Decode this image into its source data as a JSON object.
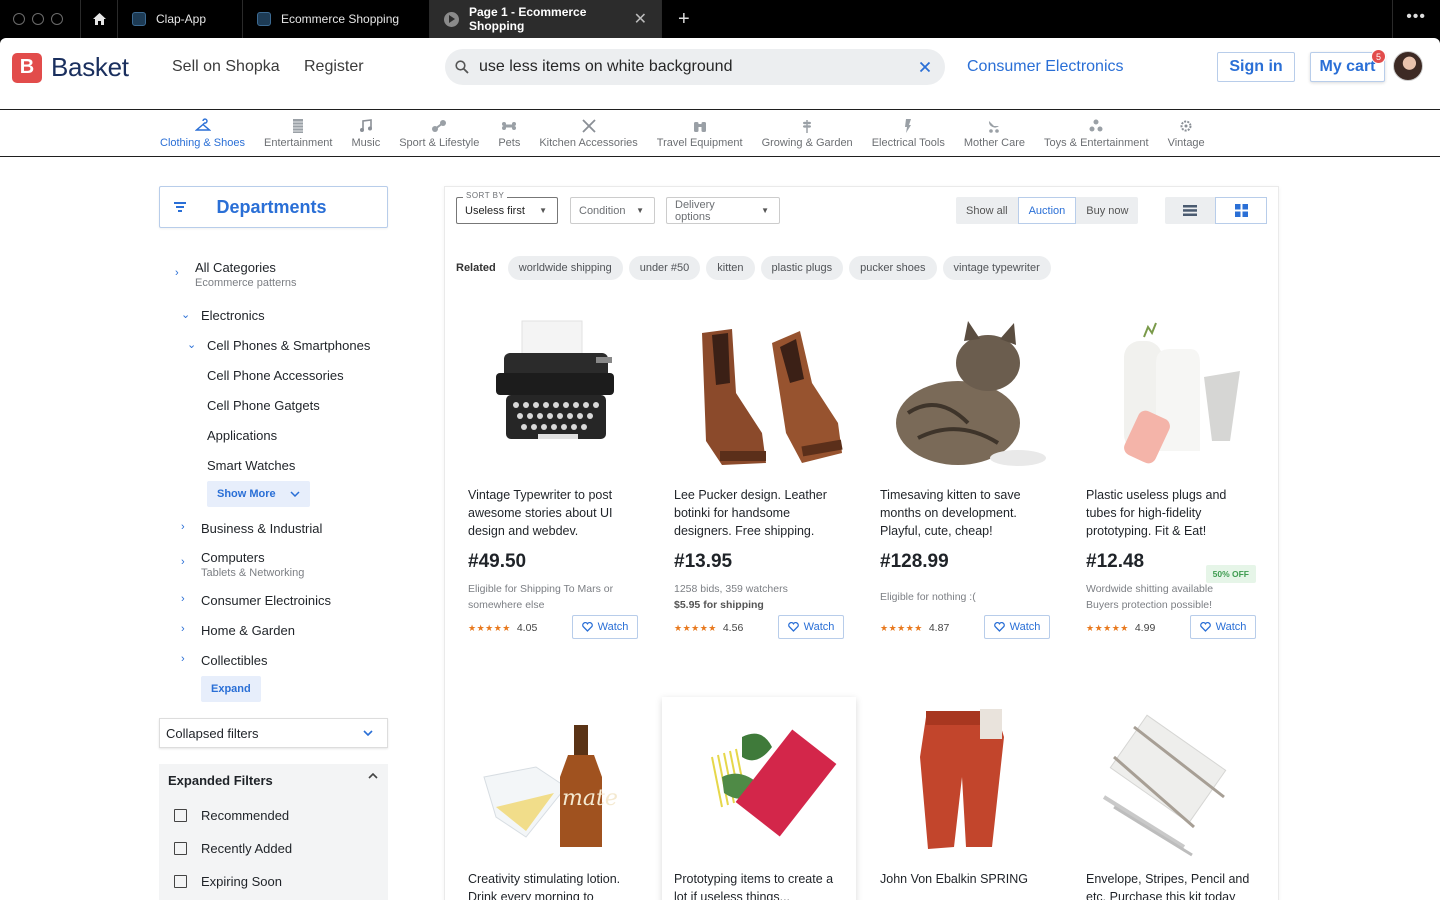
{
  "browser": {
    "tabs": [
      {
        "label": "Clap-App"
      },
      {
        "label": "Ecommerce Shopping"
      },
      {
        "label": "Page 1 - Ecommerce Shopping",
        "active": true
      }
    ],
    "new_tab": "+",
    "close": "✕",
    "more": "•••"
  },
  "header": {
    "logo_letter": "B",
    "logo_text": "Basket",
    "links": [
      "Sell on Shopka",
      "Register"
    ],
    "search_value": "use less items on white background",
    "category_link": "Consumer Electronics",
    "sign_in": "Sign in",
    "cart": "My cart",
    "cart_count": "5"
  },
  "categories": [
    {
      "label": "Clothing & Shoes",
      "icon": "hanger-icon",
      "active": true
    },
    {
      "label": "Entertainment",
      "icon": "film-icon"
    },
    {
      "label": "Music",
      "icon": "music-icon"
    },
    {
      "label": "Sport & Lifestyle",
      "icon": "bike-icon"
    },
    {
      "label": "Pets",
      "icon": "bone-icon"
    },
    {
      "label": "Kitchen Accessories",
      "icon": "utensils-icon"
    },
    {
      "label": "Travel Equipment",
      "icon": "binoculars-icon"
    },
    {
      "label": "Growing & Garden",
      "icon": "wheat-icon"
    },
    {
      "label": "Electrical Tools",
      "icon": "plug-icon"
    },
    {
      "label": "Mother Care",
      "icon": "stroller-icon"
    },
    {
      "label": "Toys & Entertainment",
      "icon": "toys-icon"
    },
    {
      "label": "Vintage",
      "icon": "gear-icon"
    }
  ],
  "sidebar": {
    "departments": "Departments",
    "tree": {
      "all": "All Categories",
      "all_sub": "Ecommerce patterns",
      "electronics": "Electronics",
      "cell": "Cell Phones & Smartphones",
      "cell_children": [
        "Cell Phone Accessories",
        "Cell Phone Gatgets",
        "Applications",
        "Smart Watches"
      ],
      "show_more": "Show More",
      "business": "Business & Industrial",
      "computers": "Computers",
      "computers_sub": "Tablets & Networking",
      "consumer": "Consumer Electroinics",
      "home": "Home & Garden",
      "collectibles": "Collectibles",
      "expand": "Expand"
    },
    "collapsed_filters": "Collapsed filters",
    "expanded_filters": "Expanded Filters",
    "checks": [
      "Recommended",
      "Recently Added",
      "Expiring Soon"
    ]
  },
  "toolbar": {
    "sort_label": "SORT BY",
    "sort_value": "Useless first",
    "condition": "Condition",
    "delivery": "Delivery options",
    "filters": [
      "Show all",
      "Auction",
      "Buy now"
    ],
    "active_filter": "Auction"
  },
  "related": {
    "label": "Related",
    "chips": [
      "worldwide shipping",
      "under #50",
      "kitten",
      "plastic plugs",
      "pucker shoes",
      "vintage typewriter"
    ]
  },
  "watch_label": "Watch",
  "products": [
    {
      "title": "Vintage Typewriter to post awesome stories about UI design and webdev.",
      "price": "#49.50",
      "note": [
        "Eligible for Shipping To Mars or",
        "somewhere else"
      ],
      "rating": "4.05"
    },
    {
      "title": "Lee Pucker design. Leather botinki for handsome designers. Free shipping.",
      "price": "#13.95",
      "note": [
        "1258 bids, 359 watchers"
      ],
      "note_bold": "$5.95 for shipping",
      "rating": "4.56"
    },
    {
      "title": "Timesaving kitten to save months on development. Playful, cute, cheap!",
      "price": "#128.99",
      "note": [
        "Eligible for nothing :("
      ],
      "rating": "4.87"
    },
    {
      "title": "Plastic useless plugs and tubes for high-fidelity prototyping. Fit & Eat!",
      "price": "#12.48",
      "badge": "50% OFF",
      "note": [
        "Wordwide shitting available",
        "Buyers protection possible!"
      ],
      "rating": "4.99"
    },
    {
      "title": "Creativity stimulating lotion. Drink every morning to generate better ideas!"
    },
    {
      "title": "Prototyping items to create a lot if useless things..."
    },
    {
      "title": "John Von Ebalkin SPRING"
    },
    {
      "title": "Envelope, Stripes, Pencil and etc. Purchase this kit today and feel OKAY"
    }
  ],
  "stars": "★★★★★"
}
